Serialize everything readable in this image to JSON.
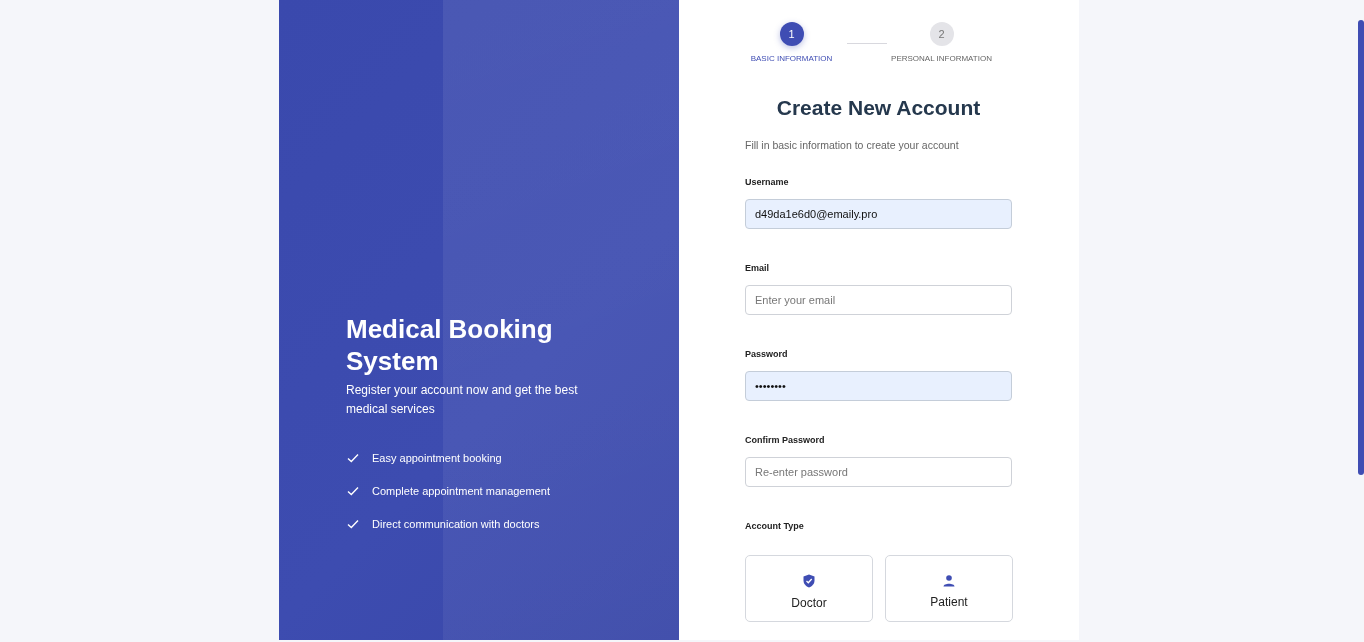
{
  "intro": {
    "title": "Medical Booking System",
    "subtitle": "Register your account now and get the best medical services",
    "features": [
      "Easy appointment booking",
      "Complete appointment management",
      "Direct communication with doctors"
    ]
  },
  "steps": [
    {
      "number": "1",
      "label": "BASIC INFORMATION",
      "selected": true
    },
    {
      "number": "2",
      "label": "PERSONAL INFORMATION",
      "selected": false
    }
  ],
  "form": {
    "title": "Create New Account",
    "subtitle": "Fill in basic information to create your account",
    "fields": [
      {
        "label": "Username",
        "value": "d49da1e6d0@emaily.pro",
        "autofilled": true
      },
      {
        "label": "Email",
        "placeholder": "Enter your email",
        "autofilled": false
      },
      {
        "label": "Password",
        "value": "••••••••",
        "autofilled": true
      },
      {
        "label": "Confirm Password",
        "placeholder": "Re-enter password",
        "autofilled": false
      }
    ],
    "account_type": {
      "label": "Account Type",
      "options": [
        {
          "label": "Doctor",
          "kind": "doctor",
          "selected": false
        },
        {
          "label": "Patient",
          "kind": "patient",
          "selected": false
        }
      ]
    }
  }
}
